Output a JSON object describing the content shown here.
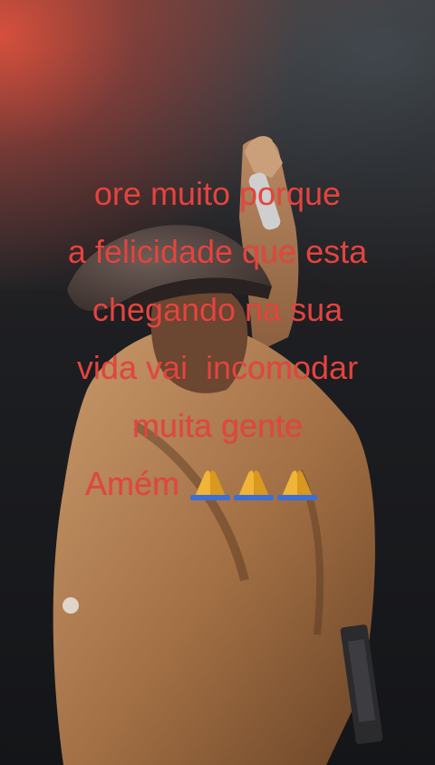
{
  "caption": {
    "lines": [
      "ore muito porque",
      "a felicidade que esta",
      "chegando na sua",
      "vida vai  incomodar",
      "muita gente"
    ],
    "closing_word": "Amém"
  },
  "icons": [
    "praying-hands-icon",
    "praying-hands-icon",
    "praying-hands-icon"
  ],
  "colors": {
    "caption_text": "#e4443f",
    "stage_light": "#d64634",
    "jacket": "#a8754a",
    "background": "#141518"
  }
}
